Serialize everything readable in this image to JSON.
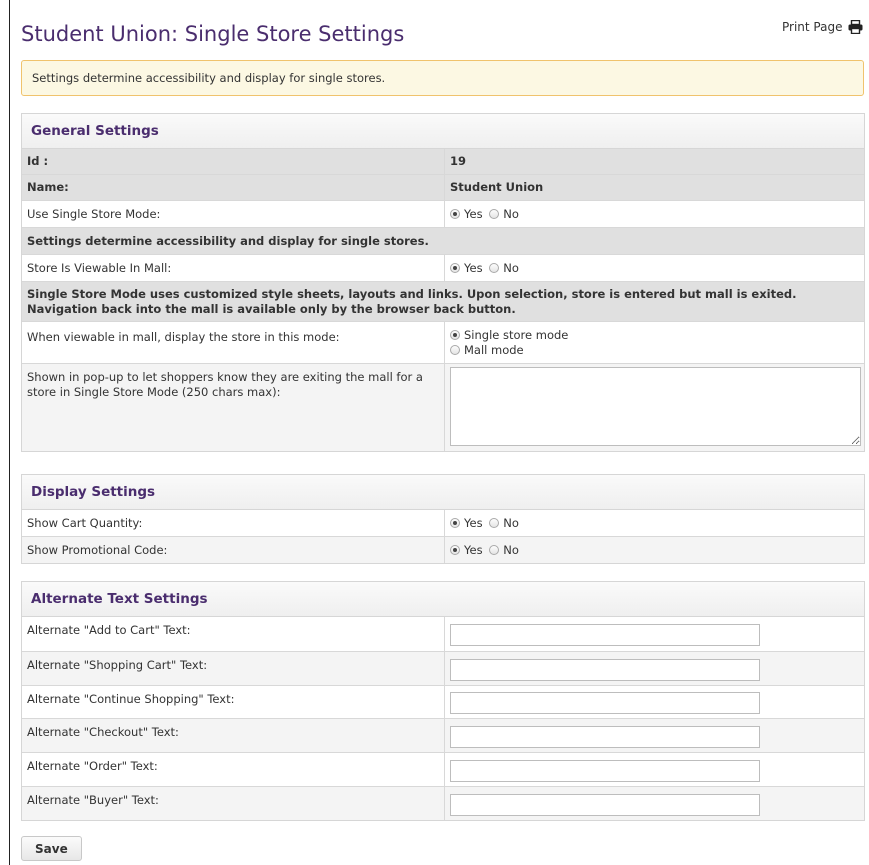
{
  "page": {
    "title": "Student Union: Single Store Settings",
    "print_label": "Print Page",
    "alert": "Settings determine accessibility and display for single stores."
  },
  "general": {
    "heading": "General Settings",
    "id_label": "Id :",
    "id_value": "19",
    "name_label": "Name:",
    "name_value": "Student Union",
    "single_store_mode_label": "Use Single Store Mode:",
    "note1": "Settings determine accessibility and display for single stores.",
    "viewable_label": "Store Is Viewable In Mall:",
    "note2": "Single Store Mode uses customized style sheets, layouts and links. Upon selection, store is entered but mall is exited. Navigation back into the mall is available only by the browser back button.",
    "display_mode_label": "When viewable in mall, display the store in this mode:",
    "display_mode_opt1": "Single store mode",
    "display_mode_opt2": "Mall mode",
    "popup_label": "Shown in pop-up to let shoppers know they are exiting the mall for a store in Single Store Mode (250 chars max):",
    "popup_value": ""
  },
  "radio": {
    "yes": "Yes",
    "no": "No"
  },
  "display": {
    "heading": "Display Settings",
    "cart_qty_label": "Show Cart Quantity:",
    "promo_label": "Show Promotional Code:"
  },
  "alternate": {
    "heading": "Alternate Text Settings",
    "rows": [
      {
        "label": "Alternate \"Add to Cart\" Text:",
        "value": ""
      },
      {
        "label": "Alternate \"Shopping Cart\" Text:",
        "value": ""
      },
      {
        "label": "Alternate \"Continue Shopping\" Text:",
        "value": ""
      },
      {
        "label": "Alternate \"Checkout\" Text:",
        "value": ""
      },
      {
        "label": "Alternate \"Order\" Text:",
        "value": ""
      },
      {
        "label": "Alternate \"Buyer\" Text:",
        "value": ""
      }
    ]
  },
  "actions": {
    "save_label": "Save"
  },
  "colors": {
    "title": "#4a2d6e",
    "alert_bg": "#fcf8e3",
    "alert_border": "#f0c36d",
    "header_row": "#e0e0e0"
  },
  "icons": {
    "print": "printer-icon"
  }
}
